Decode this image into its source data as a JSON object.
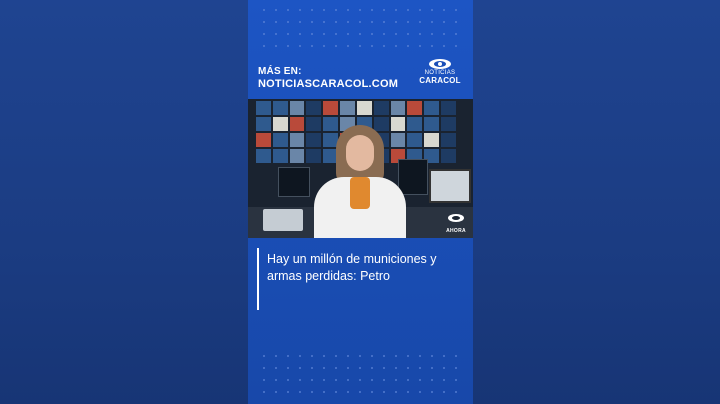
{
  "promo": {
    "mas_en": "MÁS EN:",
    "site": "NOTICIASCARACOL.COM"
  },
  "logo": {
    "line1": "NOTICIAS",
    "line2": "CARACOL"
  },
  "video": {
    "bug_label": "AHORA"
  },
  "headline": {
    "text": "Hay un millón de municiones y armas perdidas: Petro"
  },
  "colors": {
    "background": "#1c3f86",
    "panel": "#1a4fb8",
    "text": "#ffffff"
  }
}
